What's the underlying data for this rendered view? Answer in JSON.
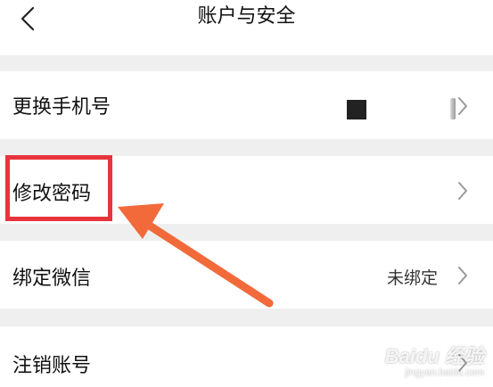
{
  "header": {
    "title": "账户与安全",
    "back_icon": "chevron-left-icon"
  },
  "rows": [
    {
      "label": "更换手机号",
      "value": ""
    },
    {
      "label": "修改密码",
      "value": ""
    },
    {
      "label": "绑定微信",
      "value": "未绑定"
    },
    {
      "label": "注销账号",
      "value": ""
    }
  ],
  "annotation": {
    "box_color": "#e8343c",
    "arrow_color": "#f26a3a"
  },
  "watermark": {
    "brand": "Baidu 经验",
    "url": "jingyan.baidu.com"
  }
}
